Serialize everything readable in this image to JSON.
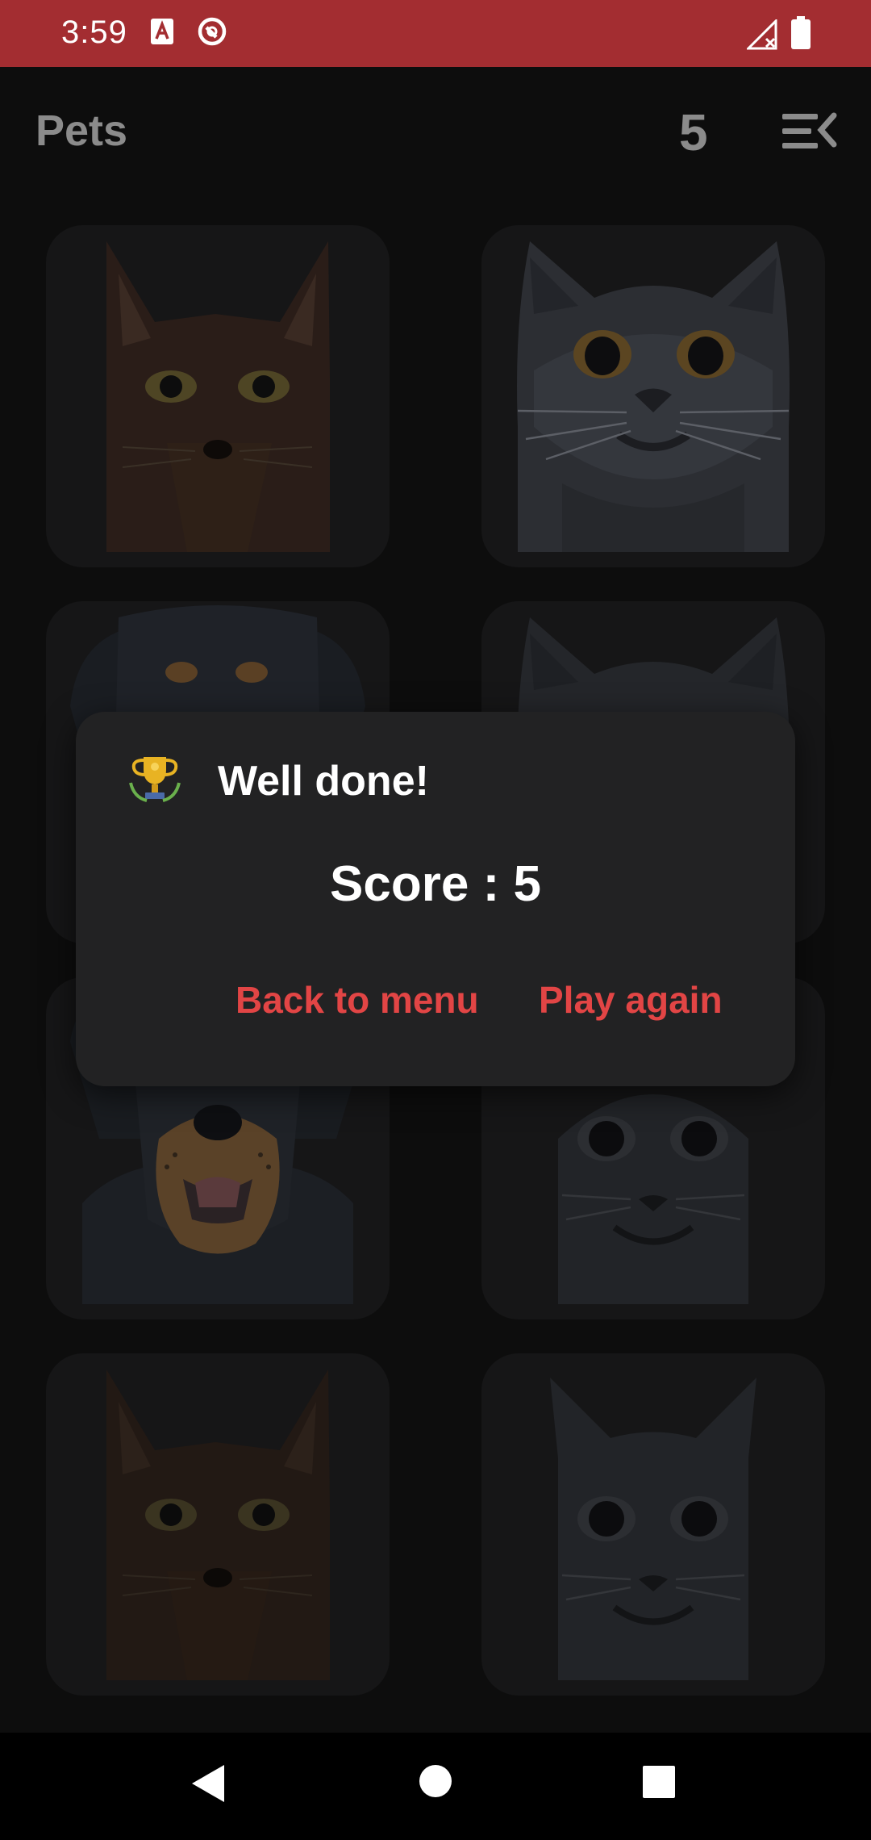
{
  "status_bar": {
    "time": "3:59",
    "background": "#a32d31",
    "icons": [
      "font-a-icon",
      "no-disturb-icon",
      "signal-icon",
      "battery-icon"
    ]
  },
  "app_bar": {
    "title": "Pets",
    "score": "5",
    "menu_icon": "menu-collapse-icon"
  },
  "grid": {
    "cards": [
      {
        "animal": "dark cat",
        "state": "face-up"
      },
      {
        "animal": "grey cat",
        "state": "face-up"
      },
      {
        "animal": "rottweiler dog",
        "state": "face-up"
      },
      {
        "animal": "grey cat",
        "state": "face-up"
      },
      {
        "animal": "rottweiler dog",
        "state": "face-up"
      },
      {
        "animal": "grey cat",
        "state": "face-up"
      },
      {
        "animal": "dark cat",
        "state": "face-up"
      },
      {
        "animal": "grey cat",
        "state": "face-up"
      }
    ]
  },
  "dialog": {
    "icon": "trophy-icon",
    "title": "Well done!",
    "score_text": "Score : 5",
    "back_label": "Back to menu",
    "again_label": "Play again",
    "accent": "#e24545"
  },
  "nav_bar": {
    "buttons": [
      "back-icon",
      "home-icon",
      "recents-icon"
    ]
  }
}
